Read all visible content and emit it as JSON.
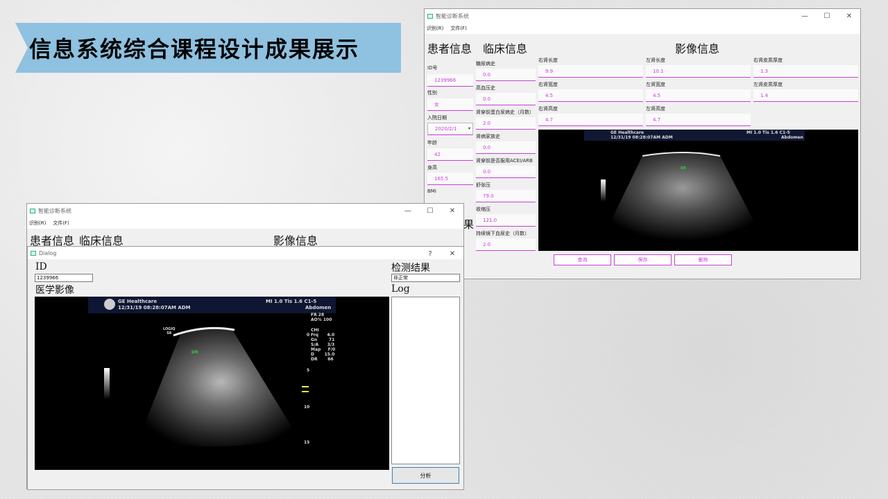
{
  "slide": {
    "banner_title": "信息系统综合课程设计成果展示"
  },
  "main_window": {
    "title": "智能诊断系统",
    "menu": [
      "识别(R)",
      "文件(F)"
    ],
    "controls": {
      "minimize": "—",
      "maximize": "☐",
      "close": "✕"
    },
    "sections": {
      "patient": "患者信息",
      "clinical": "临床信息",
      "imaging": "影像信息"
    },
    "patient_fields": [
      {
        "label": "ID号",
        "value": "1239966"
      },
      {
        "label": "性别",
        "value": "女"
      },
      {
        "label": "入院日期",
        "value": "2020/2/1"
      },
      {
        "label": "年龄",
        "value": "42"
      },
      {
        "label": "身高",
        "value": "165.5"
      },
      {
        "label": "BMI",
        "value": ""
      }
    ],
    "clinical_fields": [
      {
        "label": "糖尿病史",
        "value": "0.0"
      },
      {
        "label": "高血压史",
        "value": "0.0"
      },
      {
        "label": "肾穿前蛋白尿病史（月数）",
        "value": "2.0"
      },
      {
        "label": "肾病家族史",
        "value": "0.0"
      },
      {
        "label": "肾穿前是否服用ACEI/ARB",
        "value": "0.0"
      },
      {
        "label": "舒张压",
        "value": "79.0"
      },
      {
        "label": "收缩压",
        "value": "121.0"
      },
      {
        "label": "持续镜下血尿史（月数）",
        "value": "2.0"
      }
    ],
    "imaging_fields": [
      {
        "label": "右肾长度",
        "value": "9.9"
      },
      {
        "label": "左肾长度",
        "value": "10.1"
      },
      {
        "label": "右肾皮质厚度",
        "value": "1.3"
      },
      {
        "label": "右肾宽度",
        "value": "4.5"
      },
      {
        "label": "左肾宽度",
        "value": "4.5"
      },
      {
        "label": "左肾皮质厚度",
        "value": "1.4"
      },
      {
        "label": "右肾高度",
        "value": "4.7"
      },
      {
        "label": "左肾高度",
        "value": "4.7"
      }
    ],
    "buttons": {
      "query": "查询",
      "save": "保存",
      "delete": "删除"
    }
  },
  "ultrasound": {
    "vendor": "GE Healthcare",
    "datetime": "12/31/19 08:28:07AM  ADM",
    "mi": "MI 1.0   Tis 1.6 C1-5",
    "region": "Abdomen",
    "fr": "FR      28",
    "ao": "AO%   100",
    "probe": "LOGIQ\nS8",
    "chi_params": "CHI\nFrq      4.0\nGn        71\nS/A      3/3\nMap     F/0\nD       15.0\nDR       66",
    "depth_marks": [
      "0",
      "5",
      "10",
      "15"
    ],
    "marker": "DR"
  },
  "background_window": {
    "title": "智能诊断系统",
    "menu": [
      "识别(R)",
      "文件(F)"
    ],
    "sections": {
      "patient": "患者信息",
      "clinical": "临床信息",
      "imaging": "影像信息"
    }
  },
  "dialog": {
    "title": "Dialog",
    "help": "?",
    "close": "✕",
    "id_label": "ID",
    "id_value": "1239966",
    "image_label": "医学影像",
    "result_label": "检测结果",
    "result_value": "非正常",
    "log_label": "Log",
    "analyze_button": "分析"
  },
  "overlap_text": "果"
}
